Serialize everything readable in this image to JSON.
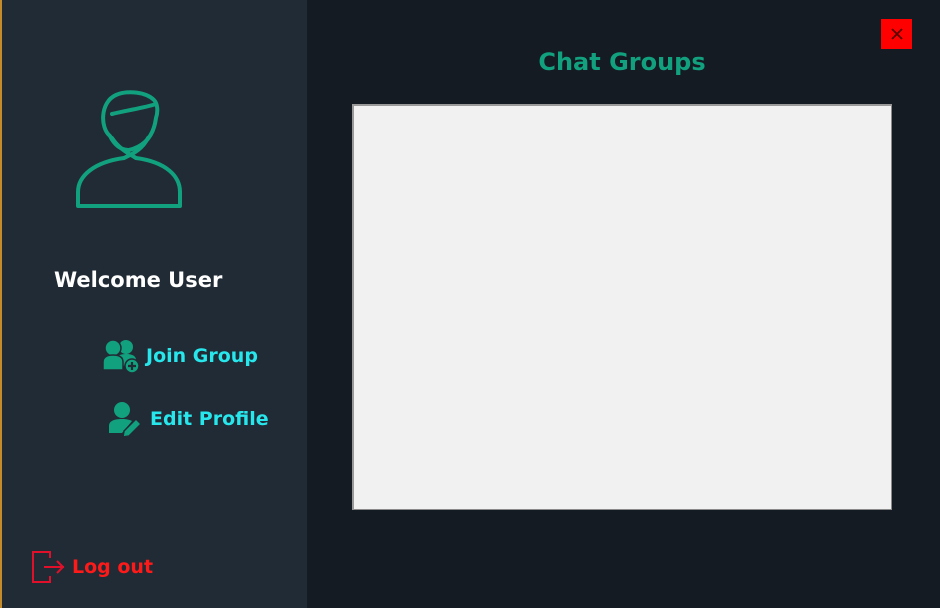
{
  "sidebar": {
    "avatar_icon": "user-outline-icon",
    "welcome_text": "Welcome User",
    "items": [
      {
        "label": "Join Group",
        "icon": "add-group-icon"
      },
      {
        "label": "Edit Profile",
        "icon": "edit-user-icon"
      }
    ],
    "logout": {
      "label": "Log out",
      "icon": "logout-icon"
    }
  },
  "main": {
    "title": "Chat Groups",
    "groups": []
  },
  "window": {
    "close_icon": "close-icon"
  },
  "colors": {
    "sidebar_bg": "#212b35",
    "main_bg": "#141b23",
    "accent_green": "#12a17e",
    "nav_text": "#27e6ec",
    "logout_red": "#ff1a1a",
    "close_red": "#ff0000"
  }
}
